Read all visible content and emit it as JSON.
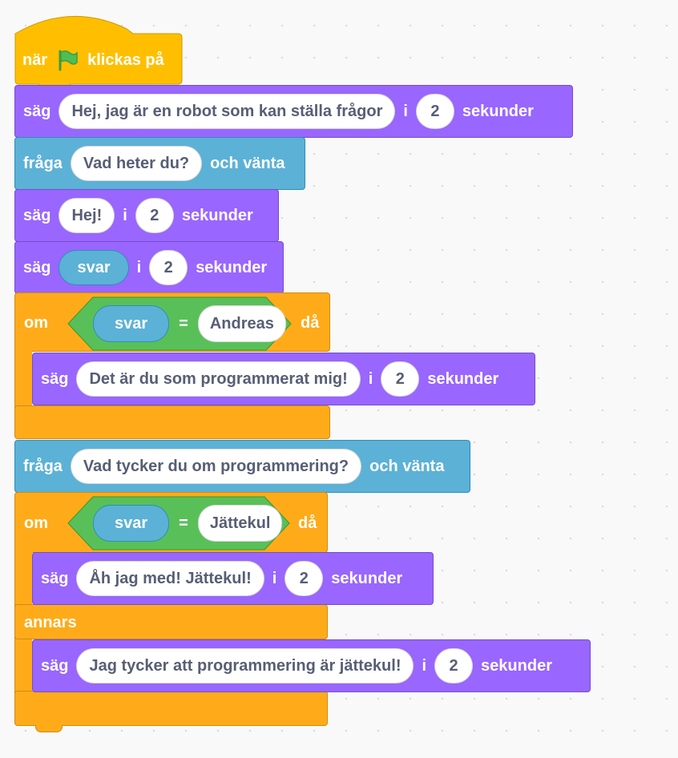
{
  "event": {
    "prefix": "när",
    "icon": "green-flag-icon",
    "suffix": "klickas på"
  },
  "say_intro": {
    "verb": "säg",
    "message": "Hej, jag är en robot som kan ställa frågor",
    "in": "i",
    "secs": "2",
    "unit": "sekunder"
  },
  "ask1": {
    "verb": "fråga",
    "question": "Vad heter du?",
    "suffix": "och vänta"
  },
  "say_hej": {
    "verb": "säg",
    "message": "Hej!",
    "in": "i",
    "secs": "2",
    "unit": "sekunder"
  },
  "say_svar": {
    "verb": "säg",
    "reporter": "svar",
    "in": "i",
    "secs": "2",
    "unit": "sekunder"
  },
  "if1": {
    "keyword": "om",
    "left": "svar",
    "op": "=",
    "right": "Andreas",
    "then": "då"
  },
  "say_prog": {
    "verb": "säg",
    "message": "Det är du som programmerat mig!",
    "in": "i",
    "secs": "2",
    "unit": "sekunder"
  },
  "ask2": {
    "verb": "fråga",
    "question": "Vad tycker du om programmering?",
    "suffix": "och vänta"
  },
  "if2": {
    "keyword": "om",
    "left": "svar",
    "op": "=",
    "right": "Jättekul",
    "then": "då",
    "else": "annars"
  },
  "say_me": {
    "verb": "säg",
    "message": "Åh jag med! Jättekul!",
    "in": "i",
    "secs": "2",
    "unit": "sekunder"
  },
  "say_think": {
    "verb": "säg",
    "message": "Jag tycker att programmering är jättekul!",
    "in": "i",
    "secs": "2",
    "unit": "sekunder"
  },
  "colors": {
    "looks": "#9966ff",
    "sensing": "#5cb1d6",
    "events": "#ffbf00",
    "control": "#ffab19",
    "operators": "#59c059"
  }
}
